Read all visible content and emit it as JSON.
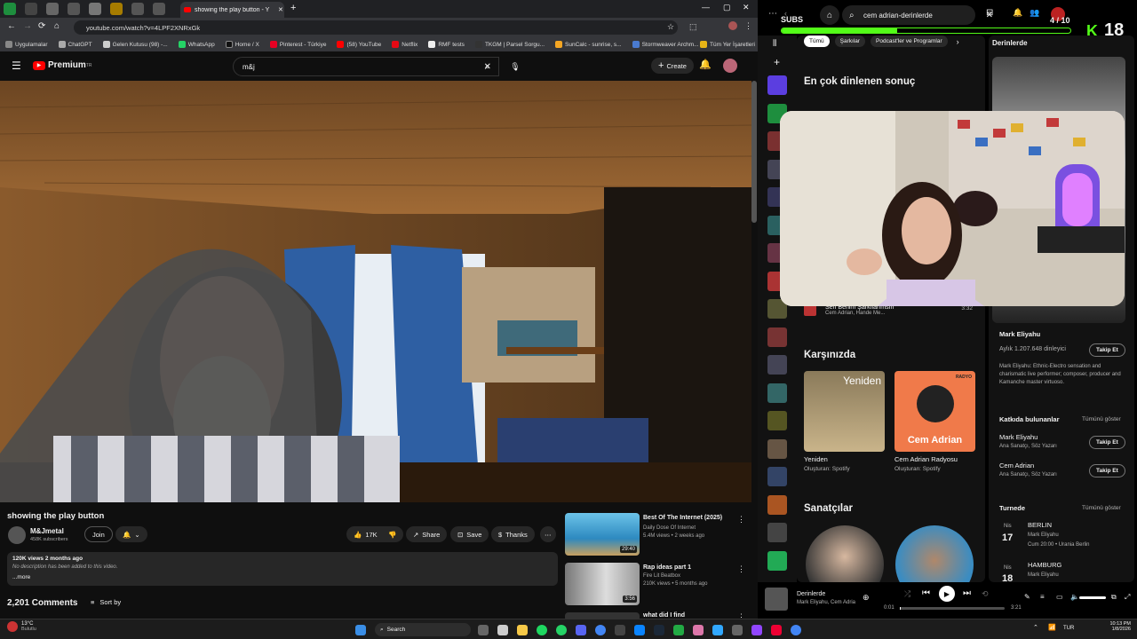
{
  "browser": {
    "tab_title": "showing the play button - Y",
    "url": "youtube.com/watch?v=4LPF2XNRxGk",
    "bookmarks": [
      "Uygulamalar",
      "ChatGPT",
      "Gelen Kutusu (98) -...",
      "WhatsApp",
      "Home / X",
      "Pinterest - Türkiye",
      "(58) YouTube",
      "Netflix",
      "RMF tests",
      "TKGM | Parsel Sorgu...",
      "SunCalc - sunrise, s...",
      "Stormweaver Archm..."
    ],
    "all_bookmarks": "Tüm Yer İşaretleri"
  },
  "youtube": {
    "logo": "Premium",
    "logo_sup": "TR",
    "search_value": "m&j",
    "create_label": "Create",
    "video_title": "showing the play button",
    "channel": "M&Jmetal",
    "subscribers": "458K subscribers",
    "join_label": "Join",
    "likes": "17K",
    "share_label": "Share",
    "save_label": "Save",
    "thanks_label": "Thanks",
    "views_line": "120K views  2 months ago",
    "description": "No description has been added to this video.",
    "more_label": "...more",
    "comments_count": "2,201 Comments",
    "sort_label": "Sort by",
    "recommendations": [
      {
        "title": "Best Of The Internet (2025)",
        "channel": "Daily Dose Of Internet",
        "meta": "5.4M views • 2 weeks ago",
        "duration": "29:40"
      },
      {
        "title": "Rap ideas part 1",
        "channel": "Fire Lit Beatbox",
        "meta": "210K views • 5 months ago",
        "duration": "3:56"
      },
      {
        "title": "what did I find",
        "channel": "",
        "meta": "",
        "duration": ""
      }
    ]
  },
  "spotify": {
    "search_value": "cem adrian-derinlerde",
    "filters": [
      "Tümü",
      "Şarkılar",
      "Podcast'ler ve Programlar"
    ],
    "top_result_heading": "En çok dinlenen sonuç",
    "song_row": {
      "title": "Sen Benim Şarkılarımsın",
      "artists": "Cem Adrian, Hande Me...",
      "duration": "3:32"
    },
    "featuring_heading": "Karşınızda",
    "cards": [
      {
        "title": "Yeniden",
        "subtitle": "Oluşturan: Spotify",
        "art_text": "Yeniden"
      },
      {
        "title": "Cem Adrian Radyosu",
        "subtitle": "Oluşturan: Spotify",
        "art_text": "Cem Adrian",
        "badge": "RADYO"
      }
    ],
    "artists_heading": "Sanatçılar",
    "right_panel": {
      "title": "Derinlerde",
      "artist": "Mark Eliyahu",
      "listeners": "Aylık 1.207.648 dinleyici",
      "follow_label": "Takip Et",
      "bio": "Mark Eliyahu: Ethnic-Electro sensation and charismatic live performer; composer, producer and Kamanche master virtuoso.",
      "credits_heading": "Katkıda bulunanlar",
      "show_all": "Tümünü göster",
      "credits": [
        {
          "name": "Mark Eliyahu",
          "role": "Ana Sanatçı, Söz Yazarı"
        },
        {
          "name": "Cem Adrian",
          "role": "Ana Sanatçı, Söz Yazarı"
        }
      ],
      "tour_heading": "Turnede",
      "tour": [
        {
          "month": "Nis",
          "day": "17",
          "city": "BERLIN",
          "artist": "Mark Eliyahu",
          "detail": "Cum 20:00 • Urania Berlin"
        },
        {
          "month": "Nis",
          "day": "18",
          "city": "HAMBURG",
          "artist": "Mark Eliyahu",
          "detail": ""
        }
      ]
    },
    "player": {
      "track": "Derinlerde",
      "artists": "Mark Eliyahu, Cem Adria",
      "elapsed": "0:01",
      "total": "3:21",
      "progress": 0.01
    }
  },
  "overlay": {
    "subs_label": "SUBS",
    "subs_count": "4 / 10",
    "counter_number": "18"
  },
  "taskbar": {
    "weather_temp": "13°C",
    "weather_desc": "Bulutlu",
    "search_label": "Search",
    "lang": "TUR",
    "time": "10:13 PM",
    "date": "1/8/2026"
  },
  "colors": {
    "yt_red": "#ff0000",
    "spotify_green": "#1ed760",
    "kick_green": "#53fc18"
  }
}
